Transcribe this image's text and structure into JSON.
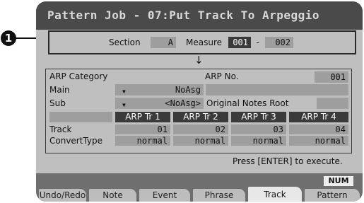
{
  "callout": {
    "number": "1"
  },
  "title": "Pattern Job - 07:Put Track To Arpeggio",
  "section": {
    "label": "Section",
    "value": "A"
  },
  "measure": {
    "label": "Measure",
    "start": "001",
    "separator": "-",
    "end": "002"
  },
  "arrow": "↓",
  "arp": {
    "category_label": "ARP Category",
    "no_label": "ARP No.",
    "no_value": "001",
    "main_label": "Main",
    "main_value": "NoAsg",
    "sub_label": "Sub",
    "sub_value": "<NoAsg>",
    "original_notes_root_label": "Original Notes Root",
    "dropdown_glyph": "▼"
  },
  "grid": {
    "columns": [
      "ARP Tr 1",
      "ARP Tr 2",
      "ARP Tr 3",
      "ARP Tr 4"
    ],
    "rows": [
      {
        "label": "Track",
        "values": [
          "01",
          "02",
          "03",
          "04"
        ]
      },
      {
        "label": "ConvertType",
        "values": [
          "normal",
          "normal",
          "normal",
          "normal"
        ]
      }
    ]
  },
  "hint": "Press [ENTER] to execute.",
  "num_badge": "NUM",
  "tabs": [
    {
      "label": "Undo/Redo",
      "active": false
    },
    {
      "label": "Note",
      "active": false
    },
    {
      "label": "Event",
      "active": false
    },
    {
      "label": "Phrase",
      "active": false
    },
    {
      "label": "Track",
      "active": true
    },
    {
      "label": "Pattern",
      "active": false
    }
  ],
  "colors": {
    "lcd_background": "#bfbfbf",
    "title_bar": "#4a4a4a",
    "highlight": "#3a3a3a",
    "value_field": "#9e9e9e"
  }
}
